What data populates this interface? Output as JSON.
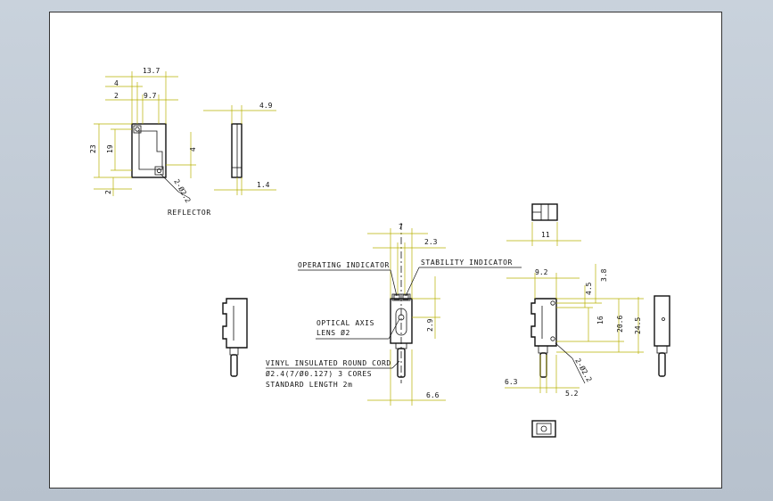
{
  "drawing": {
    "reflector": {
      "label": "REFLECTOR",
      "dims": {
        "width_total": "13.7",
        "offset_4": "4",
        "offset_2": "2",
        "width_9_7": "9.7",
        "height_23": "23",
        "height_19": "19",
        "hole_4": "4",
        "bottom_2": "2",
        "holes": "2-Ø2.2"
      },
      "side_dims": {
        "thickness": "4.9",
        "base": "1.4"
      }
    },
    "sensor_front": {
      "dims": {
        "width_7": "7",
        "width_2_3": "2.3",
        "height_2_9": "2.9",
        "cable_6_6": "6.6"
      },
      "labels": {
        "operating_indicator": "OPERATING INDICATOR",
        "stability_indicator": "STABILITY INDICATOR",
        "optical_axis_1": "OPTICAL AXIS",
        "optical_axis_2": "LENS Ø2",
        "cable_1": "VINYL INSULATED ROUND CORD",
        "cable_2": "Ø2.4(7/Ø0.127) 3 CORES",
        "cable_3": "STANDARD LENGTH 2m"
      }
    },
    "sensor_top": {
      "dims": {
        "width_11": "11"
      }
    },
    "sensor_side": {
      "dims": {
        "width_9_2": "9.2",
        "d_3_8": "3.8",
        "d_4_5": "4.5",
        "d_16": "16",
        "d_20_6": "20.6",
        "d_24_5": "24.5",
        "holes": "2-Ø2.2",
        "d_6_3": "6.3",
        "d_5_2": "5.2"
      }
    }
  }
}
